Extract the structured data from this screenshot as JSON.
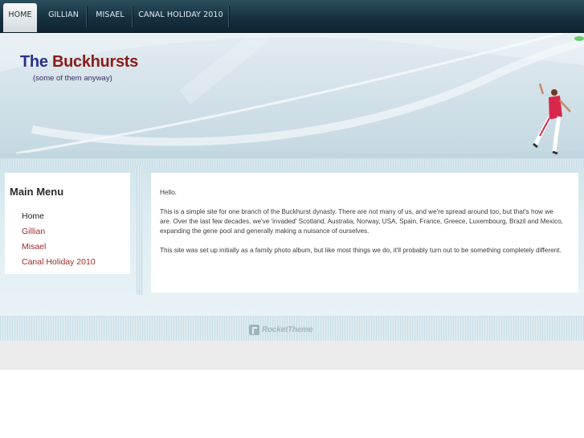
{
  "nav": {
    "tabs": [
      {
        "label": "HOME",
        "active": true
      },
      {
        "label": "GILLIAN",
        "active": false
      },
      {
        "label": "MISAEL",
        "active": false
      },
      {
        "label": "CANAL HOLIDAY 2010",
        "active": false
      }
    ]
  },
  "header": {
    "title_part1": "The",
    "title_part2": "Buckhursts",
    "subtitle": "(some of them anyway)"
  },
  "sidebar": {
    "title": "Main Menu",
    "items": [
      {
        "label": "Home",
        "active": true
      },
      {
        "label": "Gillian",
        "active": false
      },
      {
        "label": "Misael",
        "active": false
      },
      {
        "label": "Canal Holiday 2010",
        "active": false
      }
    ]
  },
  "content": {
    "paragraphs": [
      "Hello.",
      "This is a simple site for one branch of the Buckhurst dynasty. There are not many of us, and we're spread around too, but that's how we are. Over the last few decades, we've 'invaded' Scotland, Australia, Norway, USA, Spain, France, Greece, Luxembourg, Brazil and Mexico, expanding the gene pool and generally making a nuisance of ourselves.",
      "This site was set up initially as a family photo album, but like most things we do, it'll probably turn out to be something completely different."
    ]
  },
  "footer": {
    "logo_text": "RocketTheme",
    "logo_icon": "rockettheme-logo-icon"
  },
  "colors": {
    "nav_bg": "#163140",
    "title_blue": "#2a2f8c",
    "title_red": "#8c1b1b",
    "link_red": "#a22a2a"
  }
}
